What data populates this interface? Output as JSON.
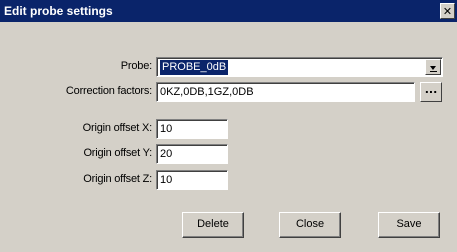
{
  "dialog": {
    "title": "Edit probe settings",
    "close_glyph": "✕"
  },
  "fields": {
    "probe_label": "Probe:",
    "probe_value": "PROBE_0dB",
    "correction_label": "Correction factors:",
    "correction_value": "0KZ,0DB,1GZ,0DB",
    "ellipsis_label": "...",
    "offset_x_label": "Origin offset X:",
    "offset_x_value": "10",
    "offset_y_label": "Origin offset Y:",
    "offset_y_value": "20",
    "offset_z_label": "Origin offset Z:",
    "offset_z_value": "10"
  },
  "buttons": {
    "delete": "Delete",
    "close": "Close",
    "save": "Save"
  },
  "colors": {
    "titlebar": "#0a246a",
    "face": "#d4d0c8",
    "selection": "#0a246a"
  }
}
